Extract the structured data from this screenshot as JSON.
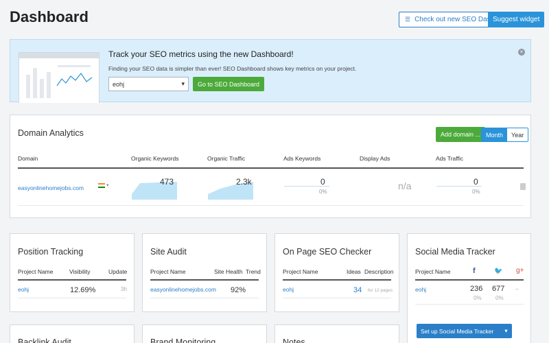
{
  "header": {
    "title": "Dashboard",
    "check_btn": "Check out new SEO Dashboard",
    "suggest_btn": "Suggest widget"
  },
  "banner": {
    "title": "Track your SEO metrics using the new Dashboard!",
    "subtitle": "Finding your SEO data is simpler than ever! SEO Dashboard shows key metrics on your project.",
    "select_value": "eohj",
    "go_btn": "Go to SEO Dashboard"
  },
  "domain_analytics": {
    "title": "Domain Analytics",
    "add_btn": "Add domain ...",
    "toggle": [
      "Month",
      "Year"
    ],
    "columns": [
      "Domain",
      "Organic Keywords",
      "Organic Traffic",
      "Ads Keywords",
      "Display Ads",
      "Ads Traffic"
    ],
    "row": {
      "domain": "easyonlinehomejobs.com",
      "organic_keywords": "473",
      "organic_traffic": "2.3k",
      "ads_keywords": "0",
      "ads_keywords_pct": "0%",
      "display_ads": "n/a",
      "ads_traffic": "0",
      "ads_traffic_pct": "0%"
    }
  },
  "position_tracking": {
    "title": "Position Tracking",
    "columns": [
      "Project Name",
      "Visibility",
      "Update"
    ],
    "row": {
      "project": "eohj",
      "visibility": "12.69%",
      "update": "3h"
    }
  },
  "site_audit": {
    "title": "Site Audit",
    "columns": [
      "Project Name",
      "Site Health",
      "Trend"
    ],
    "row": {
      "project": "easyonlinehomejobs.com",
      "health": "92%"
    }
  },
  "on_page": {
    "title": "On Page SEO Checker",
    "columns": [
      "Project Name",
      "Ideas",
      "Description"
    ],
    "row": {
      "project": "eohj",
      "ideas": "34",
      "description": "for 12 pages"
    }
  },
  "social": {
    "title": "Social Media Tracker",
    "columns": [
      "Project Name"
    ],
    "row": {
      "project": "eohj",
      "fb": "236",
      "fb_pct": "0%",
      "tw": "677",
      "tw_pct": "0%",
      "gp": "–"
    },
    "btn": "Set up Social Media Tracker"
  },
  "bottom_widgets": [
    "Backlink Audit",
    "Brand Monitoring",
    "Notes"
  ],
  "colors": {
    "accent": "#2a93d9",
    "green": "#4caa3b",
    "link": "#2a7fc8",
    "banner_bg": "#dbeefb"
  }
}
